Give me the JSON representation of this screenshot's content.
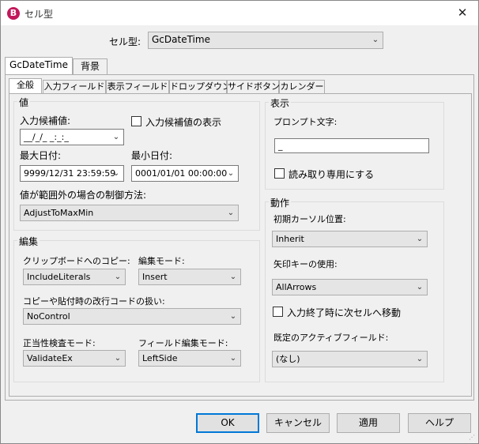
{
  "window": {
    "title": "セル型",
    "close_glyph": "✕",
    "app_icon_glyph": "B"
  },
  "celltype": {
    "label": "セル型:",
    "value": "GcDateTime"
  },
  "outer_tabs": [
    "GcDateTime",
    "背景"
  ],
  "inner_tabs": [
    "全般",
    "入力フィールド",
    "表示フィールド",
    "ドロップダウン",
    "サイドボタン",
    "カレンダー"
  ],
  "value_group": {
    "title": "値",
    "candidate_label": "入力候補値:",
    "candidate_value": "__/_/_ _:_:_",
    "show_candidate_label": "入力候補値の表示",
    "max_label": "最大日付:",
    "max_value": "9999/12/31 23:59:59",
    "min_label": "最小日付:",
    "min_value": "0001/01/01 00:00:00",
    "outofrange_label": "値が範囲外の場合の制御方法:",
    "outofrange_value": "AdjustToMaxMin"
  },
  "edit_group": {
    "title": "編集",
    "clipboard_label": "クリップボードへのコピー:",
    "clipboard_value": "IncludeLiterals",
    "editmode_label": "編集モード:",
    "editmode_value": "Insert",
    "newline_label": "コピーや貼付時の改行コードの扱い:",
    "newline_value": "NoControl",
    "validate_label": "正当性検査モード:",
    "validate_value": "ValidateEx",
    "fieldedit_label": "フィールド編集モード:",
    "fieldedit_value": "LeftSide"
  },
  "display_group": {
    "title": "表示",
    "prompt_label": "プロンプト文字:",
    "prompt_value": "_",
    "readonly_label": "読み取り専用にする"
  },
  "behavior_group": {
    "title": "動作",
    "cursor_label": "初期カーソル位置:",
    "cursor_value": "Inherit",
    "arrow_label": "矢印キーの使用:",
    "arrow_value": "AllArrows",
    "nextcell_label": "入力終了時に次セルへ移動",
    "activefield_label": "既定のアクティブフィールド:",
    "activefield_value": "(なし)"
  },
  "buttons": {
    "ok": "OK",
    "cancel": "キャンセル",
    "apply": "適用",
    "help": "ヘルプ"
  },
  "icons": {
    "dropdown": "⌄",
    "sizegrip": "⋰"
  }
}
